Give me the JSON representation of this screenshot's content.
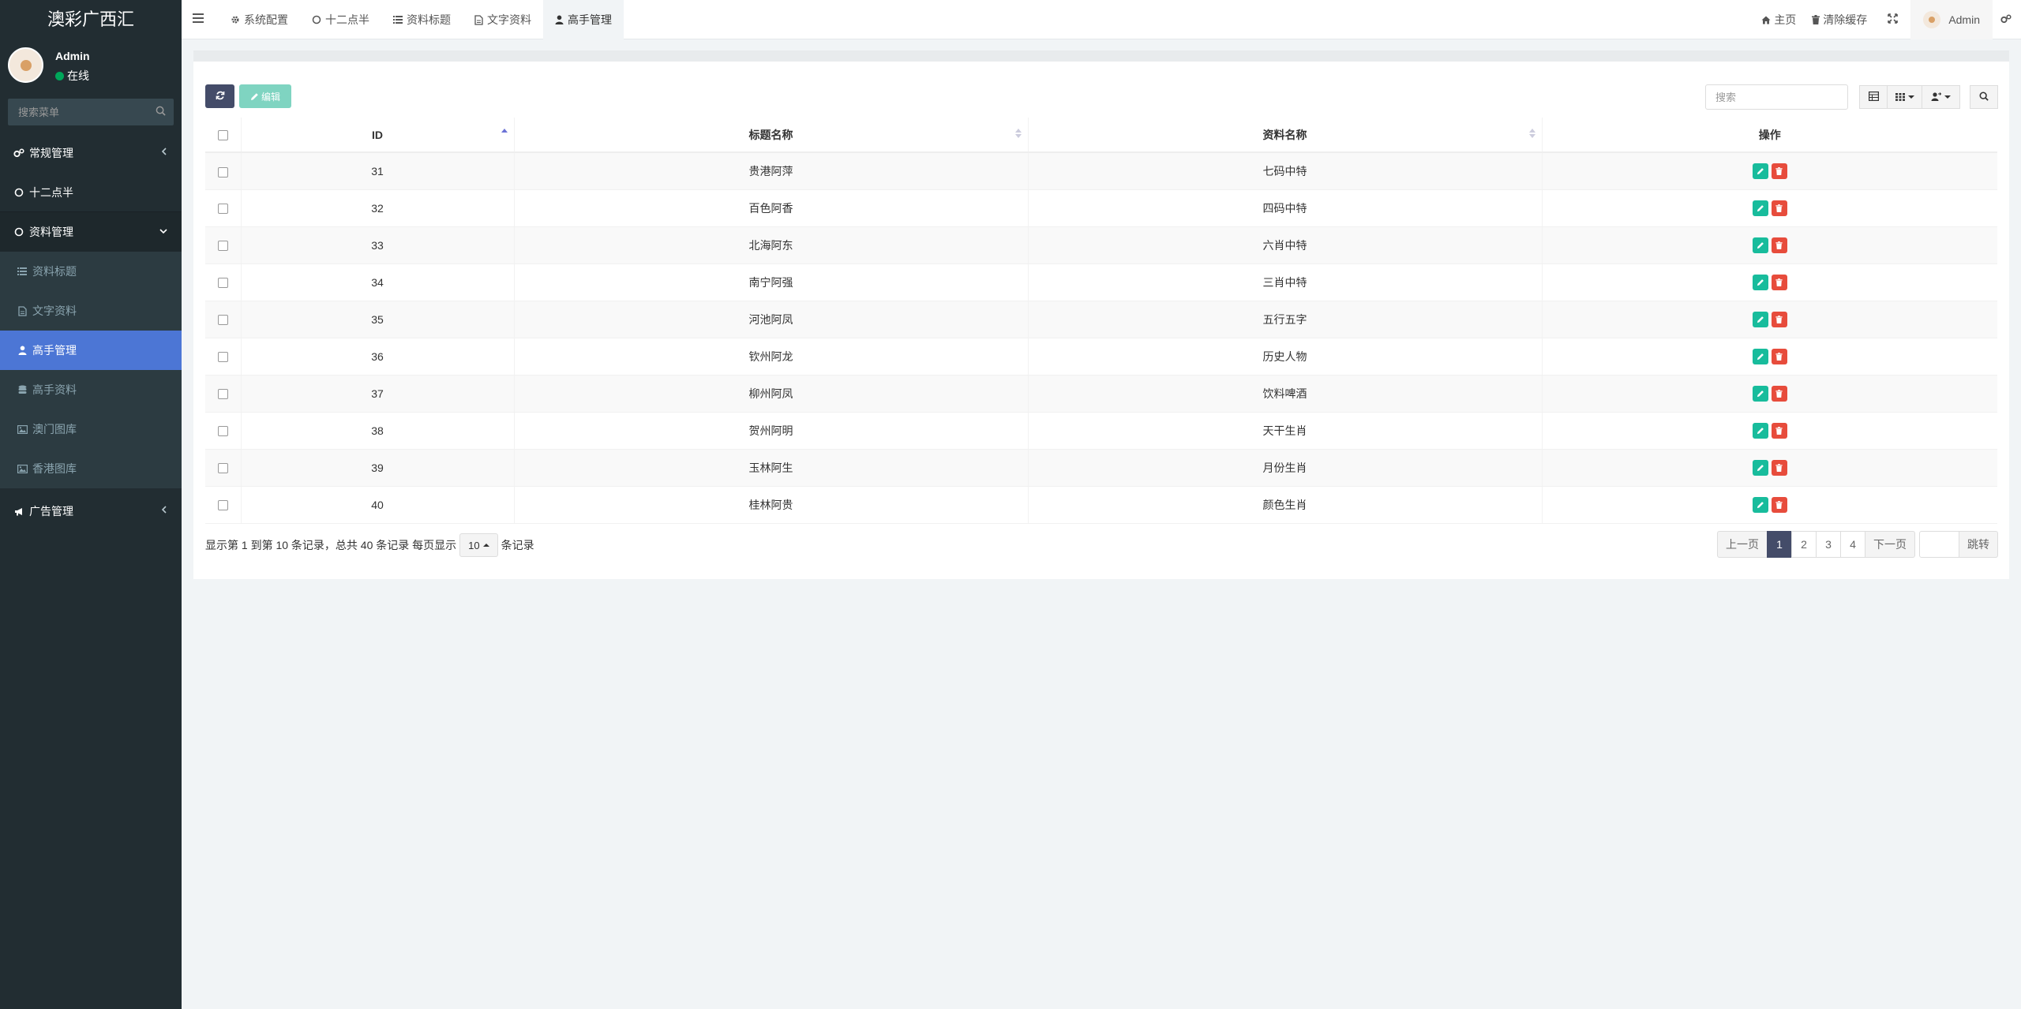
{
  "app": {
    "title": "澳彩广西汇"
  },
  "user": {
    "name": "Admin",
    "status": "在线"
  },
  "sidebar": {
    "search_placeholder": "搜索菜单",
    "items": [
      {
        "label": "常规管理",
        "icon": "gears-icon"
      },
      {
        "label": "十二点半",
        "icon": "circle-icon"
      },
      {
        "label": "资料管理",
        "icon": "circle-icon"
      },
      {
        "label": "资料标题",
        "icon": "list-icon"
      },
      {
        "label": "文字资料",
        "icon": "file-icon"
      },
      {
        "label": "高手管理",
        "icon": "user-icon"
      },
      {
        "label": "高手资料",
        "icon": "database-icon"
      },
      {
        "label": "澳门图库",
        "icon": "image-icon"
      },
      {
        "label": "香港图库",
        "icon": "image-icon"
      },
      {
        "label": "广告管理",
        "icon": "bullhorn-icon"
      }
    ]
  },
  "header": {
    "tabs": [
      {
        "label": "系统配置",
        "icon": "gear-icon"
      },
      {
        "label": "十二点半",
        "icon": "circle-icon"
      },
      {
        "label": "资料标题",
        "icon": "list-icon"
      },
      {
        "label": "文字资料",
        "icon": "file-icon"
      },
      {
        "label": "高手管理",
        "icon": "user-icon"
      }
    ],
    "home_label": "主页",
    "clear_cache_label": "清除缓存",
    "user_label": "Admin"
  },
  "toolbar": {
    "edit_label": "编辑",
    "search_placeholder": "搜索"
  },
  "table": {
    "columns": [
      "ID",
      "标题名称",
      "资料名称",
      "操作"
    ],
    "rows": [
      {
        "id": "31",
        "title": "贵港阿萍",
        "name": "七码中特"
      },
      {
        "id": "32",
        "title": "百色阿香",
        "name": "四码中特"
      },
      {
        "id": "33",
        "title": "北海阿东",
        "name": "六肖中特"
      },
      {
        "id": "34",
        "title": "南宁阿强",
        "name": "三肖中特"
      },
      {
        "id": "35",
        "title": "河池阿凤",
        "name": "五行五字"
      },
      {
        "id": "36",
        "title": "钦州阿龙",
        "name": "历史人物"
      },
      {
        "id": "37",
        "title": "柳州阿凤",
        "name": "饮料啤酒"
      },
      {
        "id": "38",
        "title": "贺州阿明",
        "name": "天干生肖"
      },
      {
        "id": "39",
        "title": "玉林阿生",
        "name": "月份生肖"
      },
      {
        "id": "40",
        "title": "桂林阿贵",
        "name": "颜色生肖"
      }
    ]
  },
  "footer": {
    "info": "显示第 1 到第 10 条记录，总共 40 条记录 每页显示",
    "page_size": "10",
    "suffix": "条记录",
    "prev": "上一页",
    "pages": [
      "1",
      "2",
      "3",
      "4"
    ],
    "next": "下一页",
    "jump": "跳转"
  },
  "colors": {
    "sidebar_bg": "#222d32",
    "active_menu": "#4c76d5",
    "primary_btn": "#444c69",
    "edit_green": "#18bc9c",
    "delete_red": "#e74c3c"
  }
}
